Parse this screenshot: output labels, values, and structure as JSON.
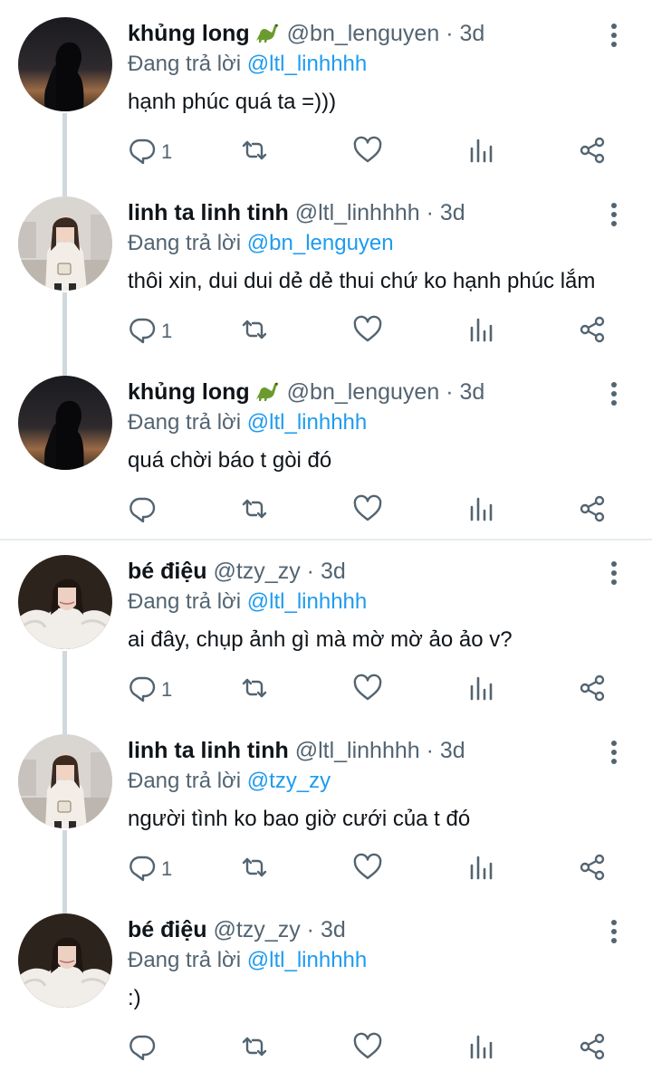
{
  "tweets": [
    {
      "name": "khủng long",
      "has_emoji": true,
      "emoji_icon": "dinosaur-icon",
      "handle": "@bn_lenguyen",
      "time": "3d",
      "reply_prefix": "Đang trả lời",
      "reply_to": "@ltl_linhhhh",
      "text": "hạnh phúc quá ta =)))",
      "reply_count": "1",
      "avatar": "silhouette"
    },
    {
      "name": "linh ta linh tinh",
      "has_emoji": false,
      "handle": "@ltl_linhhhh",
      "time": "3d",
      "reply_prefix": "Đang trả lời",
      "reply_to": "@bn_lenguyen",
      "text": "thôi xin, dui dui dẻ dẻ thui chứ ko hạnh phúc lắm",
      "reply_count": "1",
      "avatar": "girl-sweater"
    },
    {
      "name": "khủng long",
      "has_emoji": true,
      "emoji_icon": "dinosaur-icon",
      "handle": "@bn_lenguyen",
      "time": "3d",
      "reply_prefix": "Đang trả lời",
      "reply_to": "@ltl_linhhhh",
      "text": "quá chời báo t gòi đó",
      "reply_count": "",
      "avatar": "silhouette"
    },
    {
      "name": "bé điệu",
      "has_emoji": false,
      "handle": "@tzy_zy",
      "time": "3d",
      "reply_prefix": "Đang trả lời",
      "reply_to": "@ltl_linhhhh",
      "text": "ai đây, chụp ảnh gì mà mờ mờ ảo ảo v?",
      "reply_count": "1",
      "avatar": "girl-fur"
    },
    {
      "name": "linh ta linh tinh",
      "has_emoji": false,
      "handle": "@ltl_linhhhh",
      "time": "3d",
      "reply_prefix": "Đang trả lời",
      "reply_to": "@tzy_zy",
      "text": "người tình ko bao giờ cưới của t đó",
      "reply_count": "1",
      "avatar": "girl-sweater"
    },
    {
      "name": "bé điệu",
      "has_emoji": false,
      "handle": "@tzy_zy",
      "time": "3d",
      "reply_prefix": "Đang trả lời",
      "reply_to": "@ltl_linhhhh",
      "text": ":)",
      "reply_count": "",
      "avatar": "girl-fur"
    }
  ],
  "colors": {
    "accent": "#1d9bf0",
    "secondary_text": "#536471",
    "primary_text": "#0f1419",
    "thread_line": "#cfd9de",
    "separator": "#e6ecf0"
  },
  "icons": [
    "reply-icon",
    "retweet-icon",
    "like-icon",
    "analytics-icon",
    "share-icon",
    "more-options-icon"
  ]
}
